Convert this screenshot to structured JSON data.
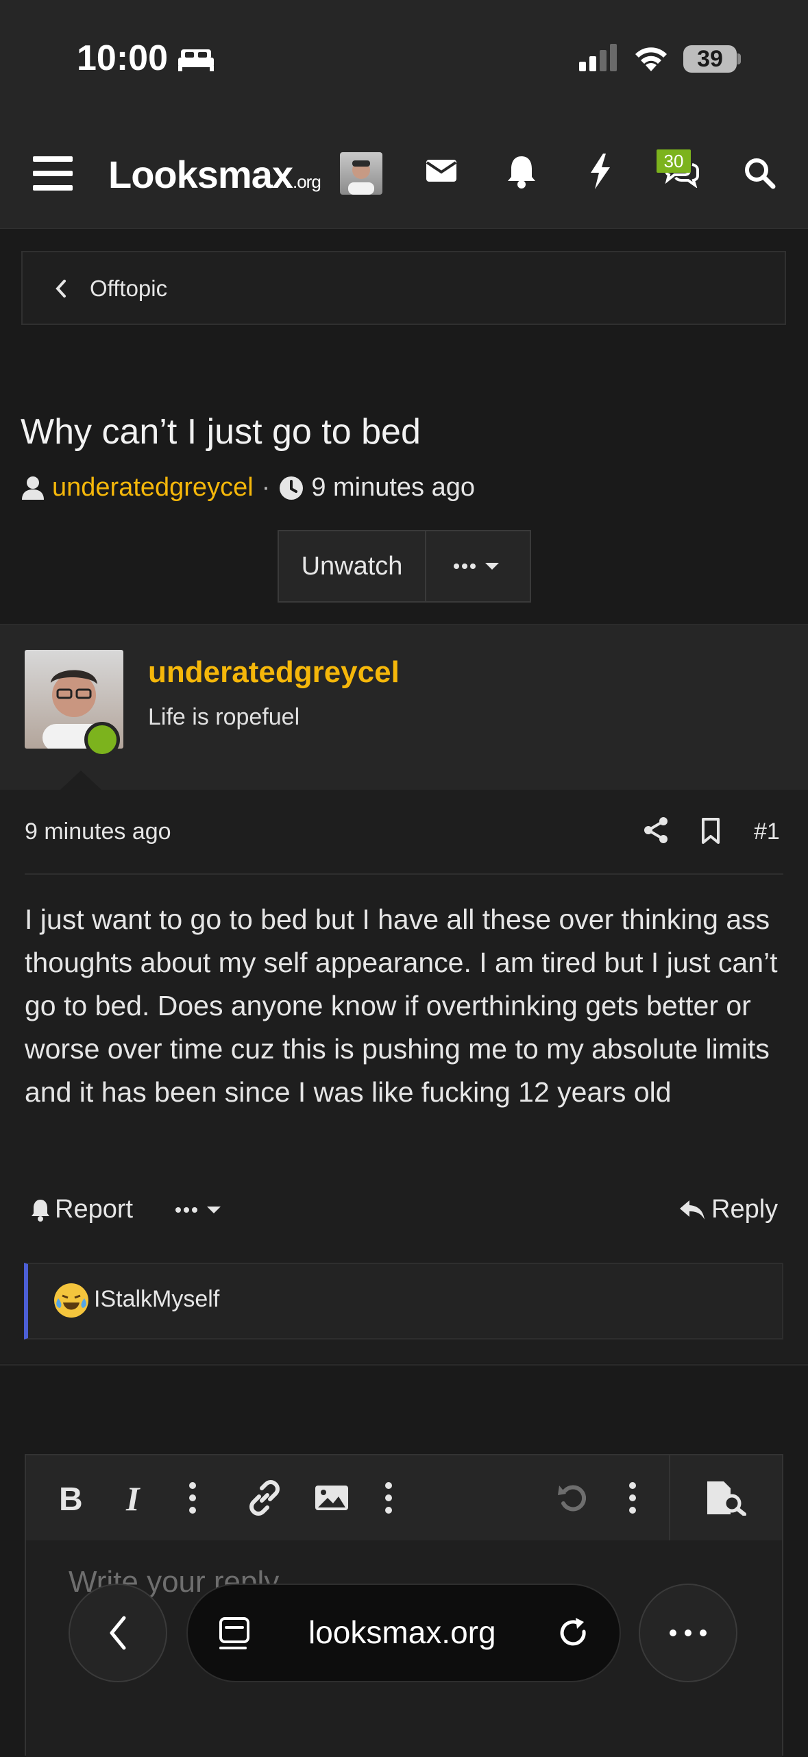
{
  "status_bar": {
    "time": "10:00",
    "battery": "39"
  },
  "navbar": {
    "logo_main": "Looksmax",
    "logo_suffix": ".org",
    "conversations_badge": "30",
    "accent_color": "#7cb31d"
  },
  "breadcrumb": {
    "label": "Offtopic"
  },
  "thread": {
    "title": "Why can’t I just go to bed",
    "author": "underatedgreycel",
    "time_ago": "9 minutes ago",
    "unwatch_label": "Unwatch"
  },
  "post": {
    "username": "underatedgreycel",
    "user_title": "Life is ropefuel",
    "time_ago": "9 minutes ago",
    "number": "#1",
    "body": "I just want to go to bed but I have all these over thinking ass thoughts about my self appearance. I am tired but I just can’t go to bed. Does anyone know if overthinking gets better or worse over time cuz this is pushing me to my absolute limits and it has been since I was like fucking 12 years old",
    "report_label": "Report",
    "reply_label": "Reply",
    "username_color": "#f5b70a"
  },
  "reactions": {
    "user": "IStalkMyself"
  },
  "editor": {
    "placeholder": "Write your reply..."
  },
  "browser": {
    "url": "looksmax.org"
  }
}
